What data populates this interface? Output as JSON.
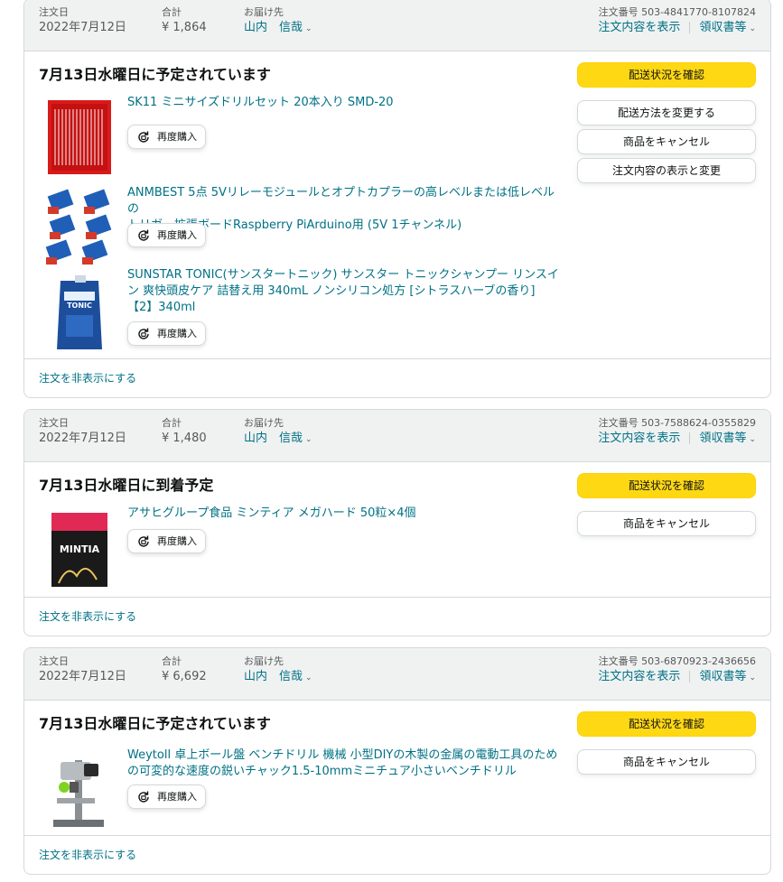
{
  "labels": {
    "order_date": "注文日",
    "total": "合計",
    "ship_to": "お届け先",
    "order_number": "注文番号",
    "view_details": "注文内容を表示",
    "invoice": "領収書等",
    "rebuy": "再度購入",
    "hide_order": "注文を非表示にする"
  },
  "orders": [
    {
      "date": "2022年7月12日",
      "total": "¥ 1,864",
      "recipient": "山内　信哉",
      "number": "503-4841770-8107824",
      "delivery": "7月13日水曜日に予定されています",
      "actions": [
        "配送状況を確認",
        "配送方法を変更する",
        "商品をキャンセル",
        "注文内容の表示と変更"
      ],
      "items": [
        {
          "title_lines": [
            "SK11 ミニサイズドリルセット 20本入り SMD-20"
          ],
          "image": "drill-set-image"
        },
        {
          "title_lines": [
            "ANMBEST 5点 5Vリレーモジュールとオプトカプラーの高レベルまたは低レベルの",
            "トリガー拡張ボードRaspberry PiArduino用 (5V 1チャンネル)"
          ],
          "image": "relay-module-image"
        },
        {
          "title_lines": [
            "SUNSTAR TONIC(サンスタートニック) サンスター トニックシャンプー リンスイ",
            "ン 爽快頭皮ケア 詰替え用 340mL ノンシリコン処方 [シトラスハーブの香り]",
            "【2】340ml"
          ],
          "image": "shampoo-image"
        }
      ]
    },
    {
      "date": "2022年7月12日",
      "total": "¥ 1,480",
      "recipient": "山内　信哉",
      "number": "503-7588624-0355829",
      "delivery": "7月13日水曜日に到着予定",
      "actions": [
        "配送状況を確認",
        "商品をキャンセル"
      ],
      "items": [
        {
          "title_lines": [
            "アサヒグループ食品 ミンティア メガハード 50粒×4個"
          ],
          "image": "mintia-image"
        }
      ]
    },
    {
      "date": "2022年7月12日",
      "total": "¥ 6,692",
      "recipient": "山内　信哉",
      "number": "503-6870923-2436656",
      "delivery": "7月13日水曜日に予定されています",
      "actions": [
        "配送状況を確認",
        "商品をキャンセル"
      ],
      "items": [
        {
          "title_lines": [
            "Weytoll 卓上ボール盤 ベンチドリル 機械 小型DIYの木製の金属の電動工具のため",
            "の可変的な速度の鋭いチャック1.5-10mmミニチュア小さいベンチドリル"
          ],
          "image": "bench-drill-image"
        }
      ]
    }
  ],
  "colors": {
    "link": "#007185",
    "primary": "#ffd814",
    "header_bg": "#f0f2f2",
    "border": "#d5d9d9"
  }
}
